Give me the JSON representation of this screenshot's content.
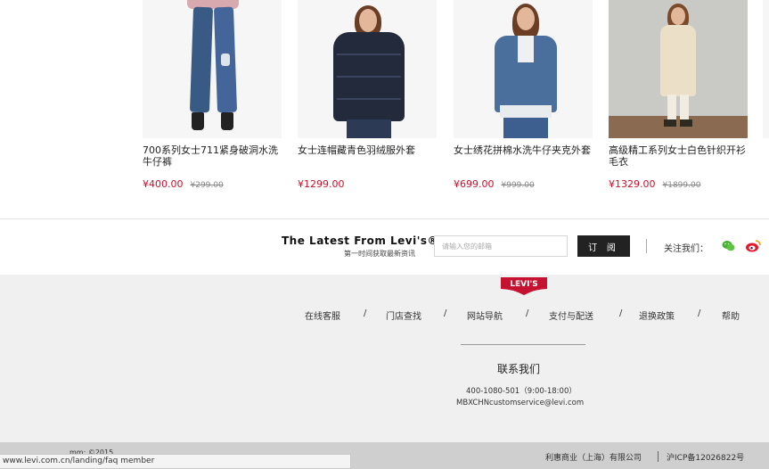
{
  "products": [
    {
      "name": "700系列女士711紧身破洞水洗牛仔裤",
      "price": "¥400.00",
      "original_price": "¥299.00"
    },
    {
      "name": "女士连帽藏青色羽绒服外套",
      "price": "¥1299.00",
      "original_price": ""
    },
    {
      "name": "女士绣花拼棉水洗牛仔夹克外套",
      "price": "¥699.00",
      "original_price": "¥999.00"
    },
    {
      "name": "高级精工系列女士白色针织开衫毛衣",
      "price": "¥1329.00",
      "original_price": "¥1899.00"
    }
  ],
  "newsletter": {
    "title": "The Latest From Levi's®",
    "subtitle": "第一时间获取最新资讯",
    "email_placeholder": "请输入您的邮箱",
    "subscribe_label": "订 阅",
    "follow_label": "关注我们："
  },
  "footer": {
    "logo_text": "Levi's",
    "links": [
      "在线客服",
      "门店查找",
      "网站导航",
      "支付与配送",
      "退换政策",
      "帮助"
    ],
    "separator": "/",
    "contact_title": "联系我们",
    "phone": "400-1080-501（9:00-18:00）",
    "email": "MBXCHNcustomservice@levi.com"
  },
  "bottom_bar": {
    "copyright_fragment": "mm: ©2015 ",
    "company": "利惠商业（上海）有限公司",
    "icp": "沪ICP备12026822号"
  },
  "status_url": "www.levi.com.cn/landing/faq member",
  "colors": {
    "price_red": "#c8102e",
    "logo_red": "#c41230",
    "wechat_green": "#49b233",
    "weibo_red": "#e6162d",
    "footer_bg": "#f0f0f0"
  }
}
